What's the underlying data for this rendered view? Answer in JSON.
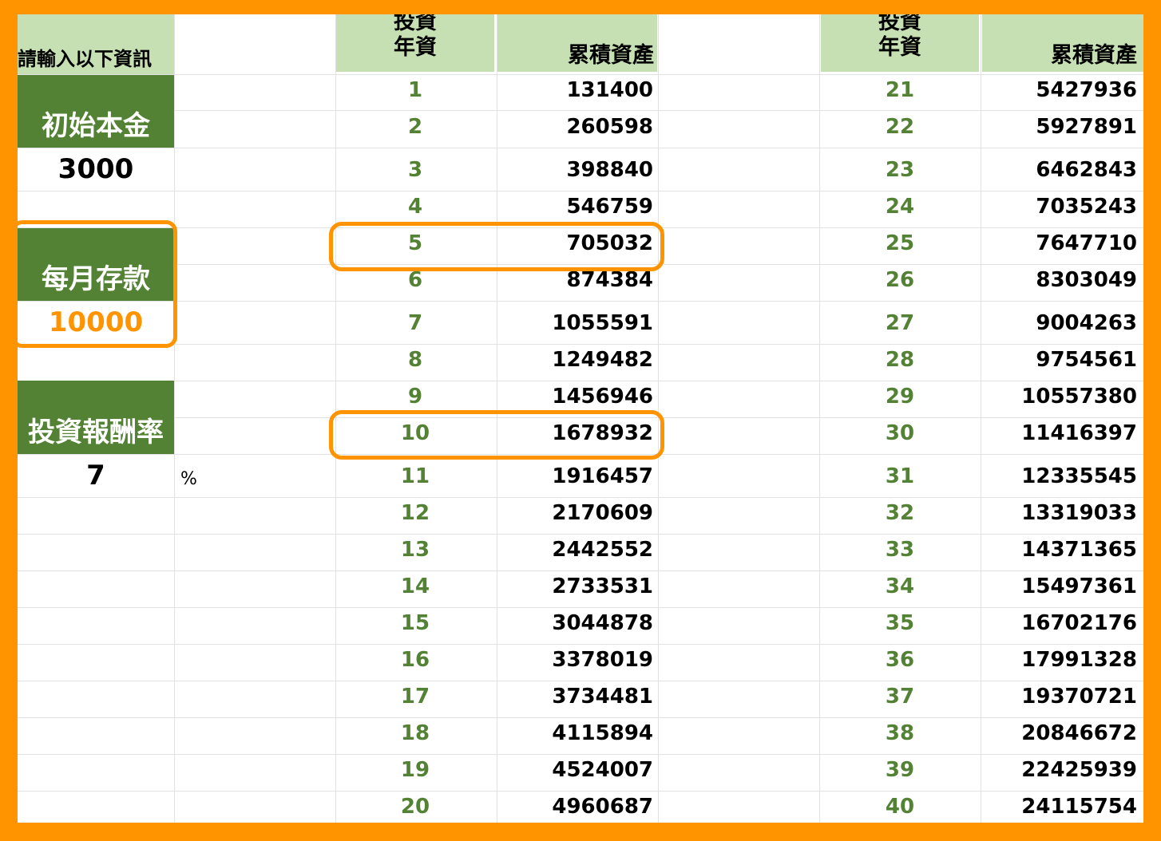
{
  "sidebar": {
    "prompt_label": "請輸入以下資訊",
    "principal_label": "初始本金",
    "principal_value": "3000",
    "monthly_label": "每月存款",
    "monthly_value": "10000",
    "rate_label": "投資報酬率",
    "rate_value": "7",
    "rate_unit": "%"
  },
  "table": {
    "year_header_line1": "投資",
    "year_header_line2": "年資",
    "asset_header": "累積資產",
    "left": [
      {
        "year": "1",
        "asset": "131400"
      },
      {
        "year": "2",
        "asset": "260598"
      },
      {
        "year": "3",
        "asset": "398840"
      },
      {
        "year": "4",
        "asset": "546759"
      },
      {
        "year": "5",
        "asset": "705032"
      },
      {
        "year": "6",
        "asset": "874384"
      },
      {
        "year": "7",
        "asset": "1055591"
      },
      {
        "year": "8",
        "asset": "1249482"
      },
      {
        "year": "9",
        "asset": "1456946"
      },
      {
        "year": "10",
        "asset": "1678932"
      },
      {
        "year": "11",
        "asset": "1916457"
      },
      {
        "year": "12",
        "asset": "2170609"
      },
      {
        "year": "13",
        "asset": "2442552"
      },
      {
        "year": "14",
        "asset": "2733531"
      },
      {
        "year": "15",
        "asset": "3044878"
      },
      {
        "year": "16",
        "asset": "3378019"
      },
      {
        "year": "17",
        "asset": "3734481"
      },
      {
        "year": "18",
        "asset": "4115894"
      },
      {
        "year": "19",
        "asset": "4524007"
      },
      {
        "year": "20",
        "asset": "4960687"
      }
    ],
    "right": [
      {
        "year": "21",
        "asset": "5427936"
      },
      {
        "year": "22",
        "asset": "5927891"
      },
      {
        "year": "23",
        "asset": "6462843"
      },
      {
        "year": "24",
        "asset": "7035243"
      },
      {
        "year": "25",
        "asset": "7647710"
      },
      {
        "year": "26",
        "asset": "8303049"
      },
      {
        "year": "27",
        "asset": "9004263"
      },
      {
        "year": "28",
        "asset": "9754561"
      },
      {
        "year": "29",
        "asset": "10557380"
      },
      {
        "year": "30",
        "asset": "11416397"
      },
      {
        "year": "31",
        "asset": "12335545"
      },
      {
        "year": "32",
        "asset": "13319033"
      },
      {
        "year": "33",
        "asset": "14371365"
      },
      {
        "year": "34",
        "asset": "15497361"
      },
      {
        "year": "35",
        "asset": "16702176"
      },
      {
        "year": "36",
        "asset": "17991328"
      },
      {
        "year": "37",
        "asset": "19370721"
      },
      {
        "year": "38",
        "asset": "20846672"
      },
      {
        "year": "39",
        "asset": "22425939"
      },
      {
        "year": "40",
        "asset": "24115754"
      }
    ]
  },
  "colors": {
    "frame": "#ff9400",
    "header_fill": "#c6e0b4",
    "label_fill": "#548235",
    "year_text": "#548235",
    "highlight": "#ff9400"
  }
}
